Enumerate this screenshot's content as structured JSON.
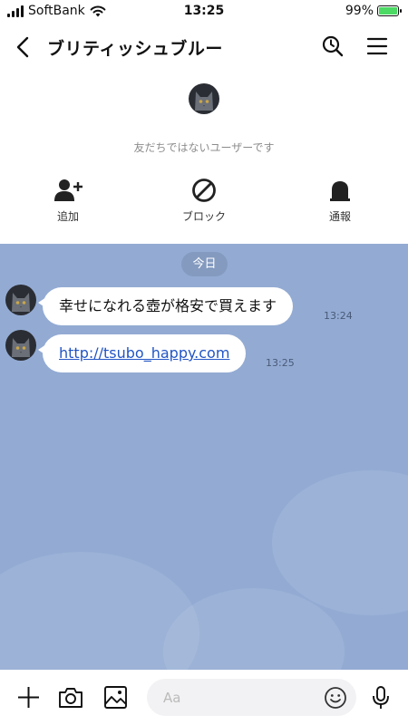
{
  "status_bar": {
    "carrier": "SoftBank",
    "time": "13:25",
    "battery": "99%",
    "battery_level": 0.99
  },
  "header": {
    "title": "ブリティッシュブルー"
  },
  "profile": {
    "not_friend_text": "友だちではないユーザーです",
    "actions": [
      {
        "label": "追加",
        "icon": "add-friend-icon"
      },
      {
        "label": "ブロック",
        "icon": "block-icon"
      },
      {
        "label": "通報",
        "icon": "report-icon"
      }
    ]
  },
  "chat": {
    "date_label": "今日",
    "messages": [
      {
        "text": "幸せになれる壺が格安で買えます",
        "time": "13:24"
      },
      {
        "text": "http://tsubo_happy.com",
        "time": "13:25",
        "is_link": true
      }
    ]
  },
  "input_bar": {
    "placeholder": "Aa"
  },
  "colors": {
    "chat_background": "#93abd3",
    "link": "#2255c5",
    "battery_fill": "#4cd964"
  }
}
